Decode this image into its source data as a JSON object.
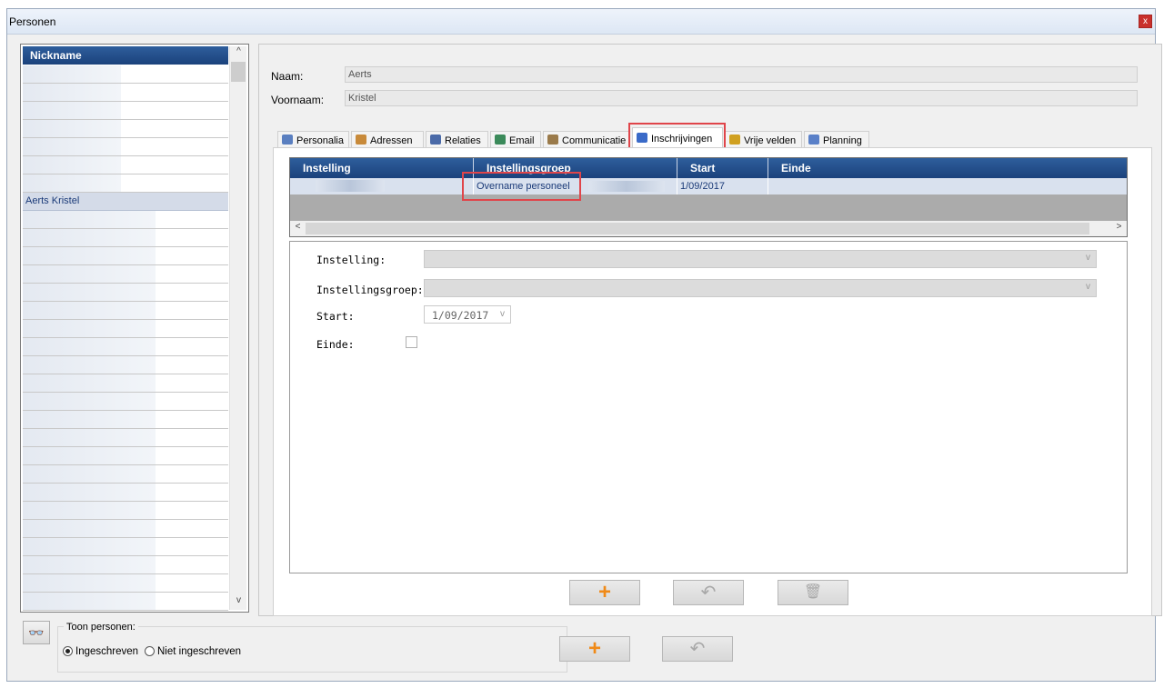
{
  "window": {
    "title": "Personen",
    "close_label": "x"
  },
  "person_list": {
    "header": "Nickname",
    "selected_item": "Aerts Kristel",
    "scroll_up": "^",
    "scroll_down": "v"
  },
  "details": {
    "naam_label": "Naam:",
    "naam_value": "Aerts",
    "voornaam_label": "Voornaam:",
    "voornaam_value": "Kristel"
  },
  "tabs": [
    {
      "label": "Personalia",
      "icon": "person-icon",
      "color": "#5a7fc0"
    },
    {
      "label": "Adressen",
      "icon": "house-icon",
      "color": "#c88a3a"
    },
    {
      "label": "Relaties",
      "icon": "contact-card-icon",
      "color": "#4a6aa8"
    },
    {
      "label": "Email",
      "icon": "globe-mail-icon",
      "color": "#3b8a5a"
    },
    {
      "label": "Communicatie",
      "icon": "telephone-icon",
      "color": "#9a7a4a"
    },
    {
      "label": "Inschrijvingen",
      "icon": "people-icon",
      "color": "#3a6ac8",
      "active": true
    },
    {
      "label": "Vrije velden",
      "icon": "notepad-icon",
      "color": "#d0a020"
    },
    {
      "label": "Planning",
      "icon": "calendar-icon",
      "color": "#5a80c8"
    }
  ],
  "grid": {
    "columns": [
      "Instelling",
      "Instellingsgroep",
      "Start",
      "Einde"
    ],
    "rows": [
      {
        "instelling": "",
        "instellingsgroep": "Overname personeel",
        "start": "1/09/2017",
        "einde": ""
      }
    ],
    "scroll_left": "<",
    "scroll_right": ">"
  },
  "form": {
    "instelling_label": "Instelling:",
    "instellingsgroep_label": "Instellingsgroep:",
    "start_label": "Start:",
    "start_value": "1/09/2017",
    "einde_label": "Einde:",
    "chevron": "v"
  },
  "buttons": {
    "add_icon": "plus-icon",
    "undo_icon": "undo-icon",
    "delete_icon": "trash-icon",
    "plus_glyph": "+",
    "undo_glyph": "↶",
    "delete_glyph": "🗑"
  },
  "bottom": {
    "search_icon": "binoculars-icon",
    "search_glyph": "👓",
    "group_label": "Toon personen:",
    "radio_ingeschreven": "Ingeschreven",
    "radio_niet_ingeschreven": "Niet ingeschreven",
    "selected_radio": "Ingeschreven"
  },
  "highlight_color": "#e0454a",
  "header_color": "#1f4a86"
}
